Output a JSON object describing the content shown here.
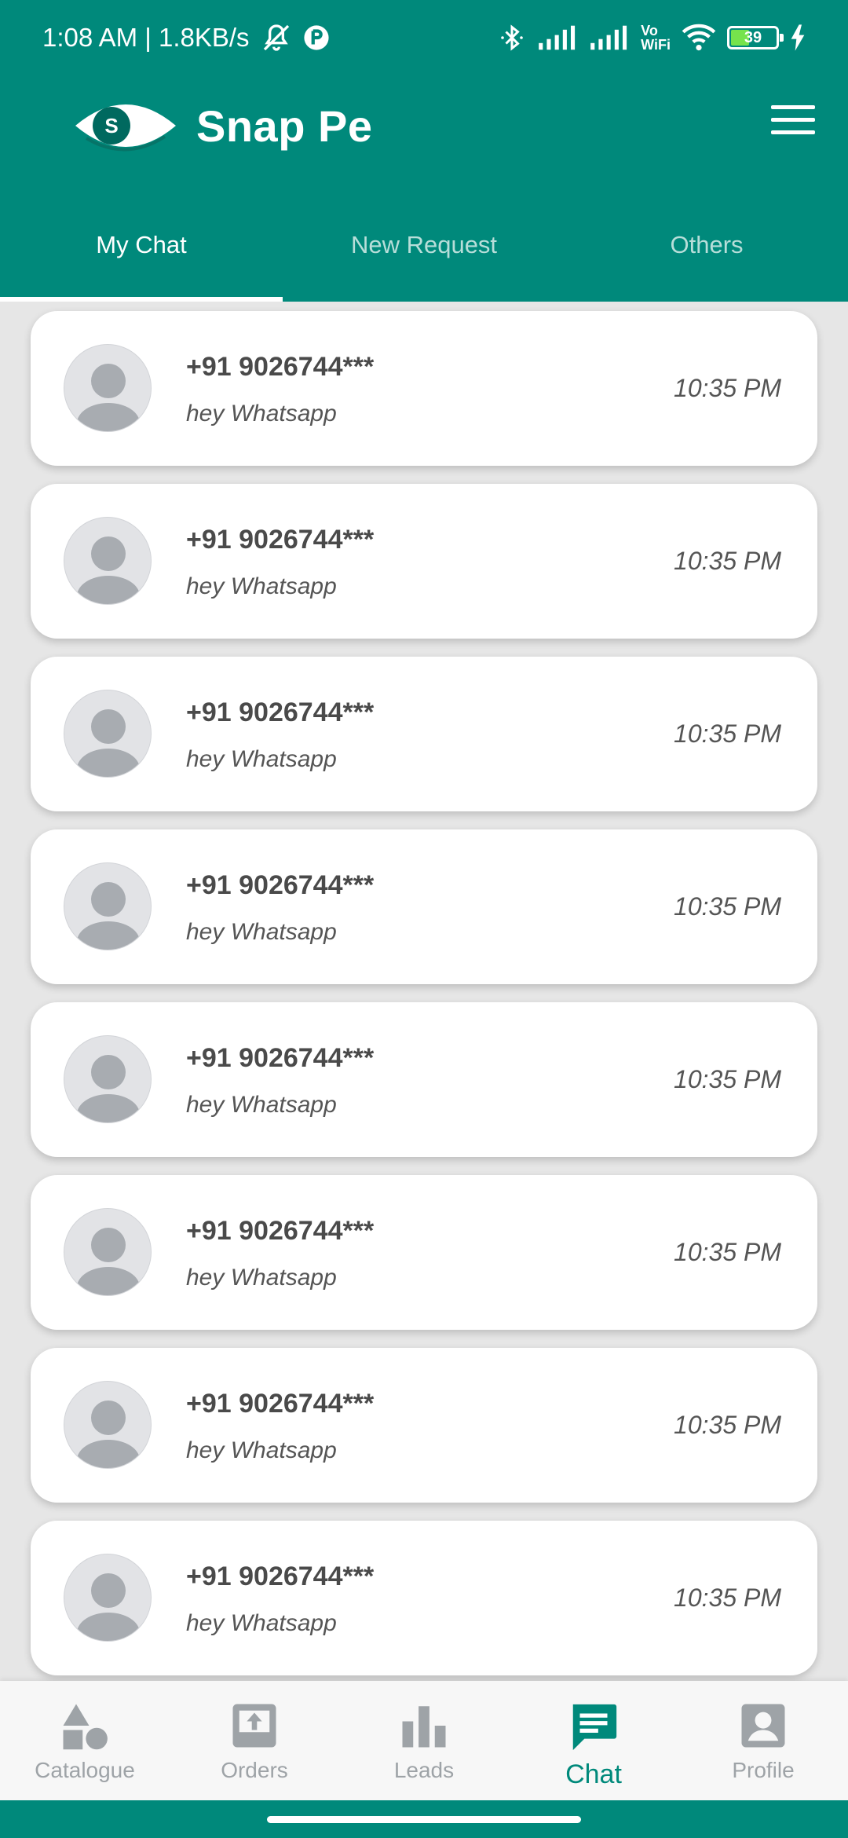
{
  "status_bar": {
    "time_speed": "1:08 AM | 1.8KB/s",
    "battery": "39",
    "vo_wifi_top": "Vo",
    "vo_wifi_bottom": "WiFi"
  },
  "header": {
    "logo_letter": "S",
    "title": "Snap Pe"
  },
  "tabs": [
    {
      "label": "My Chat",
      "active": true
    },
    {
      "label": "New Request",
      "active": false
    },
    {
      "label": "Others",
      "active": false
    }
  ],
  "chats": [
    {
      "name": "+91 9026744***",
      "message": "hey Whatsapp",
      "time": "10:35 PM"
    },
    {
      "name": "+91 9026744***",
      "message": "hey Whatsapp",
      "time": "10:35 PM"
    },
    {
      "name": "+91 9026744***",
      "message": "hey Whatsapp",
      "time": "10:35 PM"
    },
    {
      "name": "+91 9026744***",
      "message": "hey Whatsapp",
      "time": "10:35 PM"
    },
    {
      "name": "+91 9026744***",
      "message": "hey Whatsapp",
      "time": "10:35 PM"
    },
    {
      "name": "+91 9026744***",
      "message": "hey Whatsapp",
      "time": "10:35 PM"
    },
    {
      "name": "+91 9026744***",
      "message": "hey Whatsapp",
      "time": "10:35 PM"
    },
    {
      "name": "+91 9026744***",
      "message": "hey Whatsapp",
      "time": "10:35 PM"
    }
  ],
  "bottom_nav": [
    {
      "label": "Catalogue",
      "icon": "catalogue-icon",
      "active": false
    },
    {
      "label": "Orders",
      "icon": "orders-icon",
      "active": false
    },
    {
      "label": "Leads",
      "icon": "leads-icon",
      "active": false
    },
    {
      "label": "Chat",
      "icon": "chat-icon",
      "active": true
    },
    {
      "label": "Profile",
      "icon": "profile-icon",
      "active": false
    }
  ],
  "colors": {
    "brand": "#00897b",
    "inactive_nav": "#9ea3a7",
    "background": "#e6e6e6"
  }
}
